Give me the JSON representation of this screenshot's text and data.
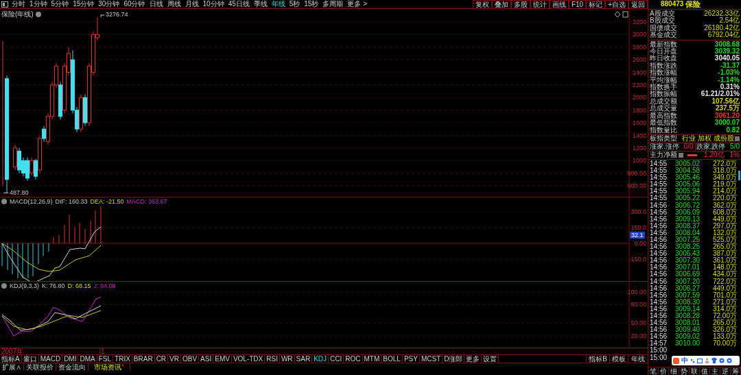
{
  "period_tabs": [
    {
      "label": "分时",
      "selected": false
    },
    {
      "label": "1分钟",
      "selected": false
    },
    {
      "label": "5分钟",
      "selected": false
    },
    {
      "label": "15分钟",
      "selected": false
    },
    {
      "label": "30分钟",
      "selected": false
    },
    {
      "label": "60分钟",
      "selected": false
    },
    {
      "label": "日线",
      "selected": false
    },
    {
      "label": "周线",
      "selected": false
    },
    {
      "label": "月线",
      "selected": false
    },
    {
      "label": "10分钟",
      "selected": false
    },
    {
      "label": "45日线",
      "selected": false
    },
    {
      "label": "季线",
      "selected": false
    },
    {
      "label": "年线",
      "selected": true
    },
    {
      "label": "5秒",
      "selected": false
    },
    {
      "label": "15秒",
      "selected": false
    },
    {
      "label": "多周期",
      "selected": false
    },
    {
      "label": "更多 >",
      "selected": false
    }
  ],
  "toolbar_buttons": [
    "复权",
    "叠加",
    "多股",
    "统计",
    "画线",
    "F10",
    "标记",
    "+自选",
    "返回"
  ],
  "main_chart": {
    "title": "保险(年线)",
    "high_marker": "3276.74",
    "low_marker": "487.80",
    "yticks": [
      "3200",
      "3000",
      "2800",
      "2600",
      "2400",
      "2200",
      "2000",
      "1800",
      "1600",
      "1400",
      "1200",
      "1000",
      "800.00",
      "600.00"
    ]
  },
  "macd": {
    "label": "MACD(12,26,9)",
    "dif": "DIF: 160.33",
    "dea": "DEA: -21.50",
    "value": "MACD: 363.67",
    "yticks": [
      "300.0",
      "150.0",
      "0.00",
      "-150.0"
    ],
    "current": "32.1"
  },
  "kdj": {
    "label": "KDJ(9,3,3)",
    "k": "K: 76.80",
    "d": "D: 68.15",
    "j": "J: 94.08",
    "yticks": [
      "100.00",
      "80.00",
      "50.00",
      "20.00"
    ]
  },
  "date_row": {
    "start": "2007年",
    "cursor": "1"
  },
  "indicator_tabs": [
    {
      "label": "指标A",
      "selected": false
    },
    {
      "label": "窗口",
      "selected": false
    },
    {
      "label": "MACD",
      "selected": false
    },
    {
      "label": "DMI",
      "selected": false
    },
    {
      "label": "DMA",
      "selected": false
    },
    {
      "label": "FSL",
      "selected": false
    },
    {
      "label": "TRIX",
      "selected": false
    },
    {
      "label": "BRAR",
      "selected": false
    },
    {
      "label": "CR",
      "selected": false
    },
    {
      "label": "VR",
      "selected": false
    },
    {
      "label": "OBV",
      "selected": false
    },
    {
      "label": "ASI",
      "selected": false
    },
    {
      "label": "EMV",
      "selected": false
    },
    {
      "label": "VOL-TDX",
      "selected": false
    },
    {
      "label": "RSI",
      "selected": false
    },
    {
      "label": "WR",
      "selected": false
    },
    {
      "label": "SAR",
      "selected": false
    },
    {
      "label": "KDJ",
      "selected": true
    },
    {
      "label": "CCI",
      "selected": false
    },
    {
      "label": "ROC",
      "selected": false
    },
    {
      "label": "MTM",
      "selected": false
    },
    {
      "label": "BOLL",
      "selected": false
    },
    {
      "label": "PSY",
      "selected": false
    },
    {
      "label": "MCST",
      "selected": false
    },
    {
      "label": "D涨郎",
      "selected": false
    },
    {
      "label": "更多",
      "selected": false
    },
    {
      "label": "设置",
      "selected": false
    }
  ],
  "indicator_right": [
    "指标B",
    "模板"
  ],
  "period_label": "年线",
  "ext_tabs": [
    {
      "label": "扩展∧",
      "selected": false
    },
    {
      "label": "关联报价",
      "selected": false
    },
    {
      "label": "资金流向",
      "selected": false
    },
    {
      "label": "市场资讯",
      "selected": true,
      "alert": "*"
    }
  ],
  "quote": {
    "code": "880473",
    "name": "保险",
    "turnover": [
      {
        "label": "A股成交",
        "value": "26232.33亿"
      },
      {
        "label": "B股成交",
        "value": "2.54亿"
      },
      {
        "label": "国债成交",
        "value": "26180.42亿"
      },
      {
        "label": "基金成交",
        "value": "6792.04亿"
      }
    ],
    "stats": [
      {
        "label": "最新指数",
        "value": "3008.68",
        "color": "#22dd22"
      },
      {
        "label": "今日开盘",
        "value": "3039.32",
        "color": "#22dd22"
      },
      {
        "label": "昨日收盘",
        "value": "3040.05",
        "color": "#e8e8e8"
      },
      {
        "label": "指数涨跌",
        "value": "-31.37",
        "color": "#22dd22"
      },
      {
        "label": "指数涨幅",
        "value": "-1.03%",
        "color": "#22dd22"
      },
      {
        "label": "平均涨幅",
        "value": "-1.14%",
        "color": "#22dd22"
      },
      {
        "label": "指数换手",
        "value": "0.31%",
        "color": "#e8e8e8"
      },
      {
        "label": "指数振幅",
        "value": "61.21/2.01%",
        "color": "#e8e8e8"
      },
      {
        "label": "总成交额",
        "value": "107.56亿",
        "color": "#d8d820"
      },
      {
        "label": "总成交量",
        "value": "237.5万",
        "color": "#d8d820"
      },
      {
        "label": "最高指数",
        "value": "3061.20",
        "color": "#ee3333"
      },
      {
        "label": "最低指数",
        "value": "3000.07",
        "color": "#22dd22"
      },
      {
        "label": "指数量比",
        "value": "0.82",
        "color": "#22dd22"
      }
    ],
    "type_label": "板指类型",
    "type_value": "行业 加权 成份股",
    "rise_label": "涨家.涨停",
    "rise_value": "0/0",
    "fall_label": "跌家.跌停",
    "fall_value": "5/0",
    "flow_label": "主力净额",
    "flow_value": "1.20亿",
    "flow_pct": "1%"
  },
  "ticks": [
    {
      "time": "14:55",
      "price": "3005.02",
      "volume": "272.0万"
    },
    {
      "time": "14:55",
      "price": "3004.58",
      "volume": "318.0万"
    },
    {
      "time": "14:55",
      "price": "3005.46",
      "volume": "349.0万"
    },
    {
      "time": "14:55",
      "price": "3005.06",
      "volume": "219.0万"
    },
    {
      "time": "14:55",
      "price": "3005.94",
      "volume": "214.0万"
    },
    {
      "time": "14:55",
      "price": "3005.22",
      "volume": "220.0万"
    },
    {
      "time": "14:56",
      "price": "3006.72",
      "volume": "362.0万"
    },
    {
      "time": "14:56",
      "price": "3006.09",
      "volume": "608.0万"
    },
    {
      "time": "14:56",
      "price": "3009.13",
      "volume": "449.0万"
    },
    {
      "time": "14:56",
      "price": "3008.37",
      "volume": "297.0万"
    },
    {
      "time": "14:56",
      "price": "3008.04",
      "volume": "132.0万"
    },
    {
      "time": "14:56",
      "price": "3007.25",
      "volume": "525.0万"
    },
    {
      "time": "14:56",
      "price": "3008.25",
      "volume": "265.0万"
    },
    {
      "time": "14:56",
      "price": "3006.43",
      "volume": "387.0万"
    },
    {
      "time": "14:56",
      "price": "3007.30",
      "volume": "361.0万"
    },
    {
      "time": "14:56",
      "price": "3007.01",
      "volume": "148.0万"
    },
    {
      "time": "14:56",
      "price": "3006.69",
      "volume": "434.0万"
    },
    {
      "time": "14:56",
      "price": "3007.20",
      "volume": "722.0万"
    },
    {
      "time": "14:56",
      "price": "3006.27",
      "volume": "449.0万"
    },
    {
      "time": "14:56",
      "price": "3007.59",
      "volume": "701.0万"
    },
    {
      "time": "14:56",
      "price": "3008.30",
      "volume": "271.0万"
    },
    {
      "time": "14:56",
      "price": "3009.14",
      "volume": "314.0万"
    },
    {
      "time": "14:56",
      "price": "3008.28",
      "volume": "72.00万"
    },
    {
      "time": "14:56",
      "price": "3008.01",
      "volume": "265.0万"
    },
    {
      "time": "14:56",
      "price": "3009.40",
      "volume": "326.0万"
    },
    {
      "time": "14:56",
      "price": "3009.02",
      "volume": "133.0万"
    },
    {
      "time": "14:57",
      "price": "3010.00",
      "volume": "70.00万"
    },
    {
      "time": "15:00"
    },
    {
      "time": "15:00"
    }
  ],
  "ime_bar": {
    "mode": "中"
  },
  "detail_tabs": [
    "笔",
    "价",
    "细",
    "势",
    "联",
    "值",
    "主",
    "逆",
    "筹"
  ]
}
